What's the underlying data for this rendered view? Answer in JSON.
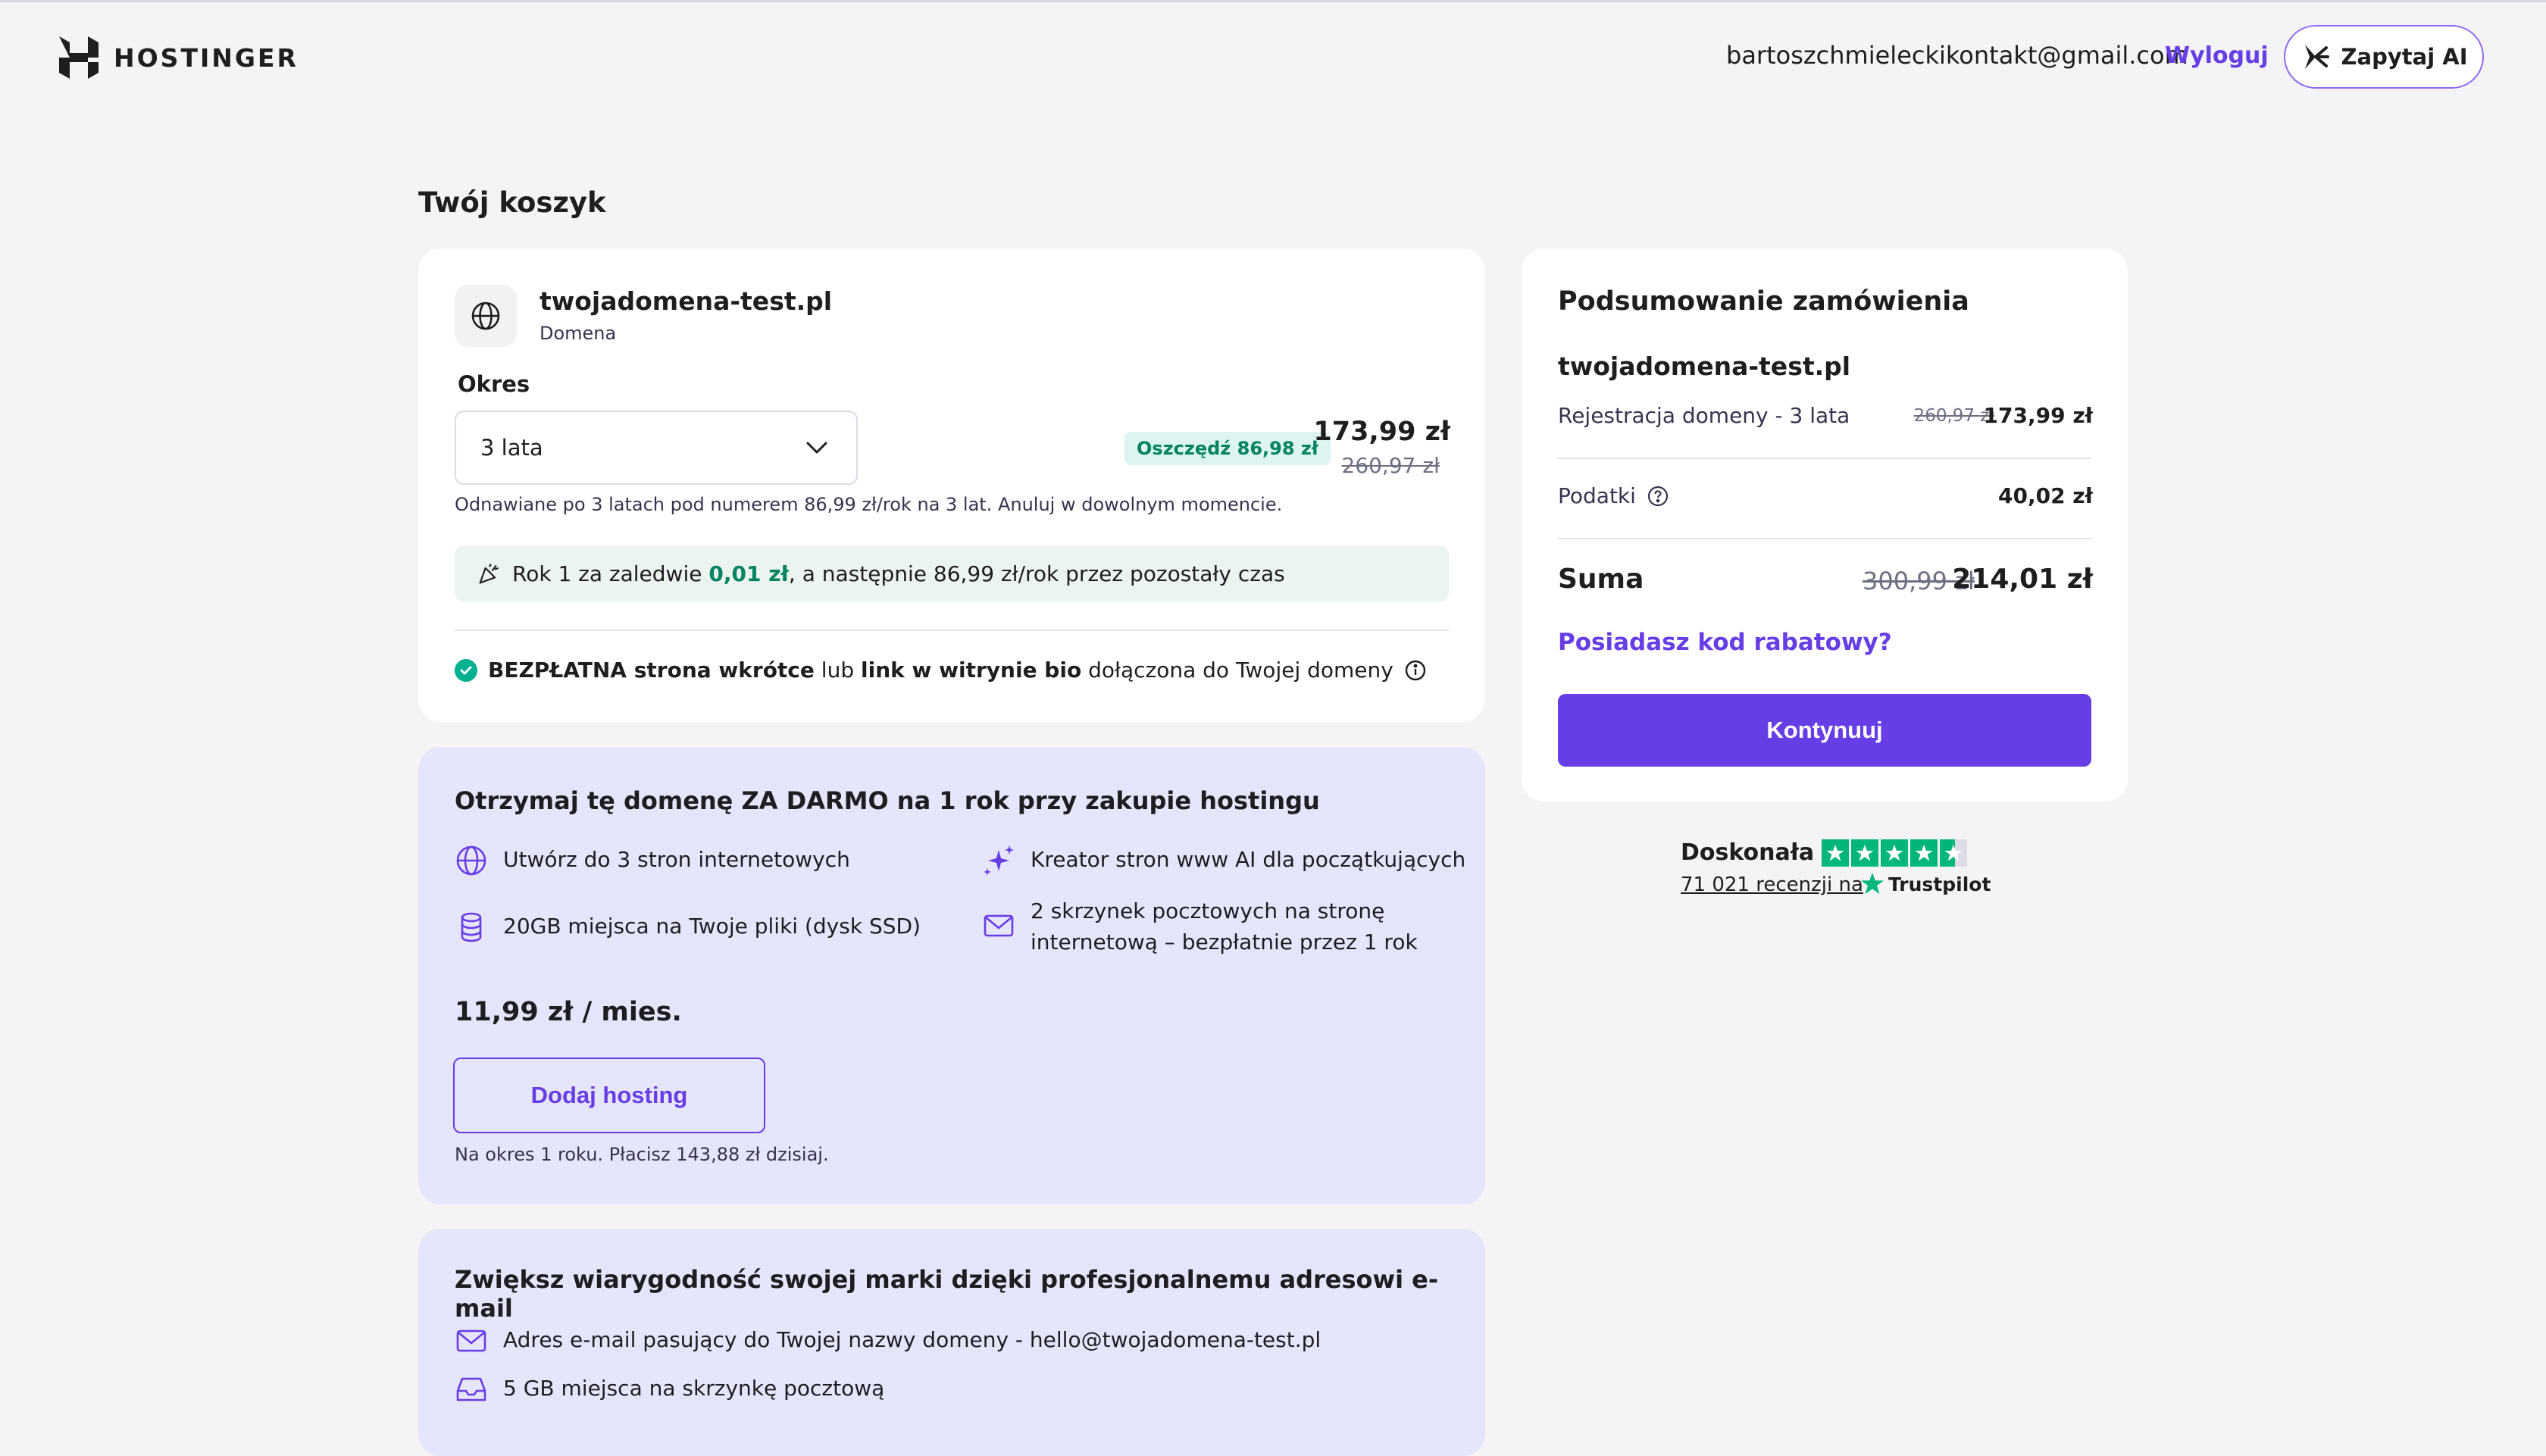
{
  "header": {
    "brand": "HOSTINGER",
    "user_email": "bartoszchmieleckikontakt@gmail.com",
    "logout_label": "Wyloguj",
    "ask_ai_label": "Zapytaj AI"
  },
  "cart": {
    "title": "Twój koszyk",
    "item": {
      "domain": "twojadomena-test.pl",
      "type": "Domena",
      "period_label": "Okres",
      "period_value": "3 lata",
      "save_badge": "Oszczędź 86,98 zł",
      "price_now": "173,99 zł",
      "price_old": "260,97 zł",
      "renew_note": "Odnawiane po 3 latach pod numerem 86,99 zł/rok na 3 lat. Anuluj w dowolnym momencie.",
      "promo_pre": "Rok 1 za zaledwie ",
      "promo_price": "0,01 zł",
      "promo_post": ", a następnie 86,99 zł/rok przez pozostały czas",
      "free_bold1": "BEZPŁATNA strona wkrótce",
      "free_mid": " lub ",
      "free_bold2": "link w witrynie bio",
      "free_post": " dołączona do Twojej domeny"
    }
  },
  "hosting_offer": {
    "title": "Otrzymaj tę domenę ZA DARMO na 1 rok przy zakupie hostingu",
    "features": [
      {
        "icon": "globe-icon",
        "text": "Utwórz do 3 stron internetowych"
      },
      {
        "icon": "sparkles-icon",
        "text": "Kreator stron www AI dla początkujących"
      },
      {
        "icon": "database-icon",
        "text": "20GB miejsca na Twoje pliki (dysk SSD)"
      },
      {
        "icon": "mail-icon",
        "text_line1": "2 skrzynek pocztowych na stronę",
        "text_line2": "internetową – bezpłatnie przez 1 rok"
      }
    ],
    "price": "11,99 zł / mies.",
    "button_label": "Dodaj hosting",
    "note": "Na okres 1 roku. Płacisz 143,88 zł dzisiaj."
  },
  "email_offer": {
    "title": "Zwiększ wiarygodność swojej marki dzięki profesjonalnemu adresowi e-mail",
    "features": [
      {
        "icon": "mail-icon",
        "text": "Adres e-mail pasujący do Twojej nazwy domeny - hello@twojadomena-test.pl"
      },
      {
        "icon": "inbox-icon",
        "text": "5 GB miejsca na skrzynkę pocztową"
      }
    ]
  },
  "summary": {
    "title": "Podsumowanie zamówienia",
    "domain": "twojadomena-test.pl",
    "registration_label": "Rejestracja domeny - 3 lata",
    "registration_old": "260,97 zł",
    "registration_now": "173,99 zł",
    "tax_label": "Podatki",
    "tax_value": "40,02 zł",
    "total_label": "Suma",
    "total_old": "300,99 zł",
    "total_now": "214,01 zł",
    "coupon_label": "Posiadasz kod rabatowy?",
    "continue_label": "Kontynuuj"
  },
  "trustpilot": {
    "rating_label": "Doskonała",
    "stars": 4.5,
    "reviews": "71 021 recenzji na",
    "brand": "Trustpilot"
  },
  "colors": {
    "accent": "#673de6",
    "promo_bg": "#e5e5fc",
    "success": "#008361",
    "trustpilot_green": "#00b67a"
  }
}
